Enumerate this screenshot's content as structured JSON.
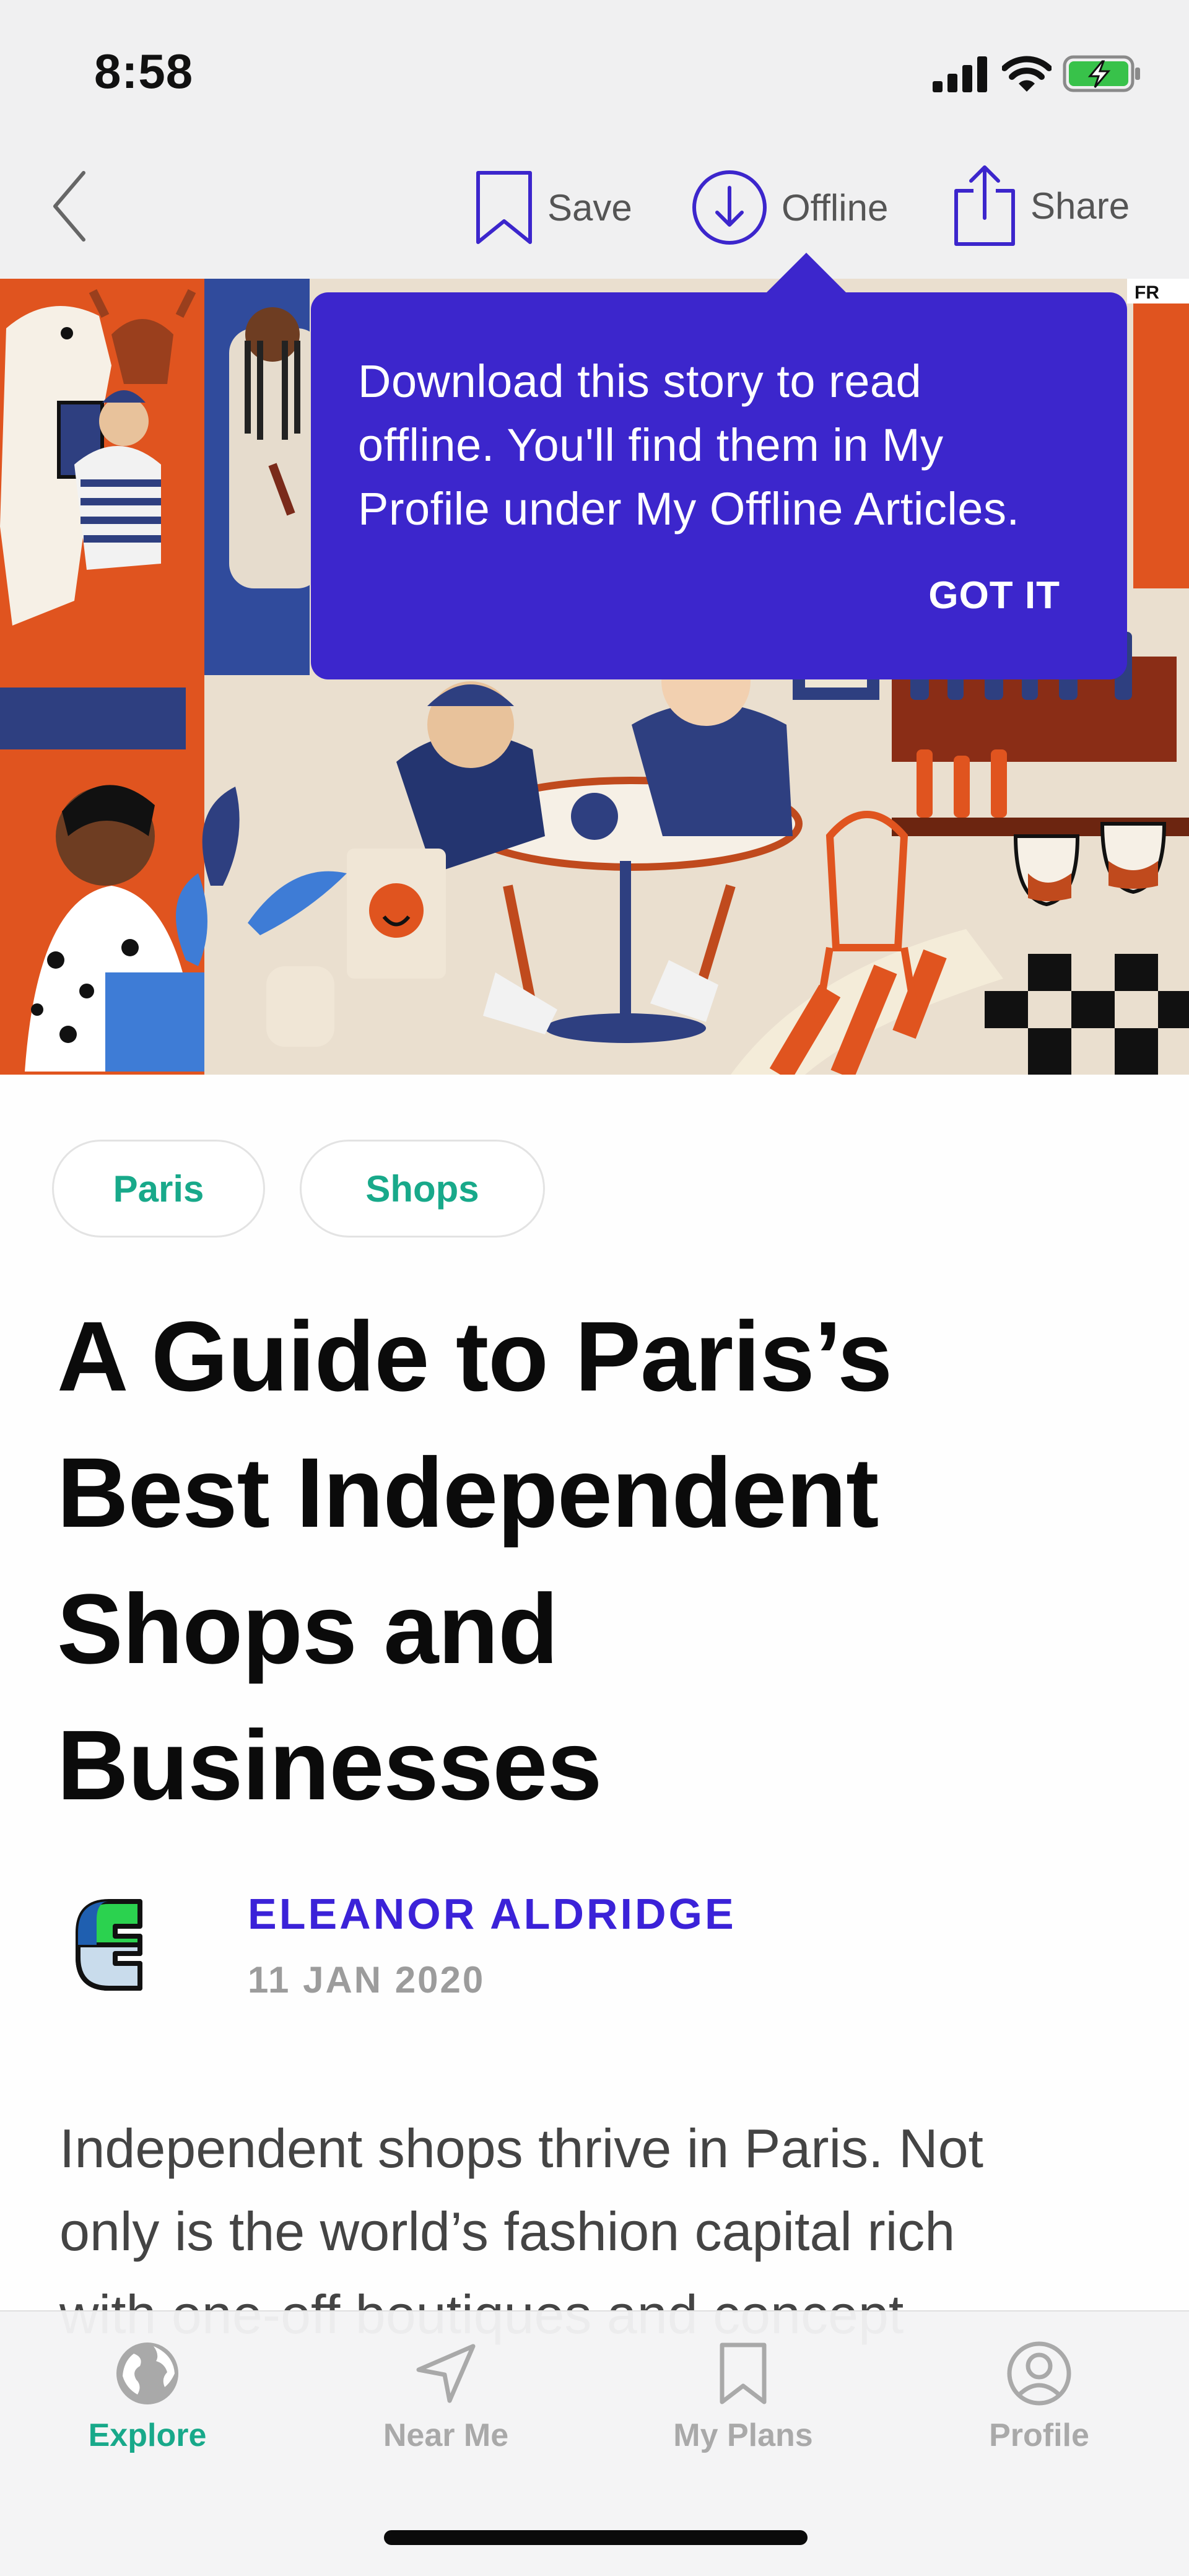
{
  "status": {
    "time": "8:58"
  },
  "nav": {
    "save_label": "Save",
    "offline_label": "Offline",
    "share_label": "Share"
  },
  "tooltip": {
    "lines": [
      "Download this story to read",
      "offline. You'll find them in My",
      "Profile under My Offline Articles."
    ],
    "action": "GOT IT"
  },
  "tags": [
    "Paris",
    "Shops"
  ],
  "article": {
    "title_lines": [
      "A Guide to Paris’s",
      "Best Independent",
      "Shops and",
      "Businesses"
    ],
    "author": "ELEANOR ALDRIDGE",
    "date": "11 JAN 2020",
    "body_lines": [
      "Independent shops thrive in Paris. Not",
      "only is the world’s fashion capital rich",
      "with one-off boutiques and concept"
    ]
  },
  "hero": {
    "sign_text": "FR"
  },
  "tabbar": {
    "tabs": [
      {
        "label": "Explore",
        "icon": "globe-icon",
        "active": true
      },
      {
        "label": "Near Me",
        "icon": "navigation-arrow-icon",
        "active": false
      },
      {
        "label": "My Plans",
        "icon": "bookmark-icon",
        "active": false
      },
      {
        "label": "Profile",
        "icon": "user-circle-icon",
        "active": false
      }
    ]
  },
  "colors": {
    "accent_purple": "#3c26cc",
    "accent_green": "#18a98a",
    "author_blue": "#3b22d8"
  }
}
